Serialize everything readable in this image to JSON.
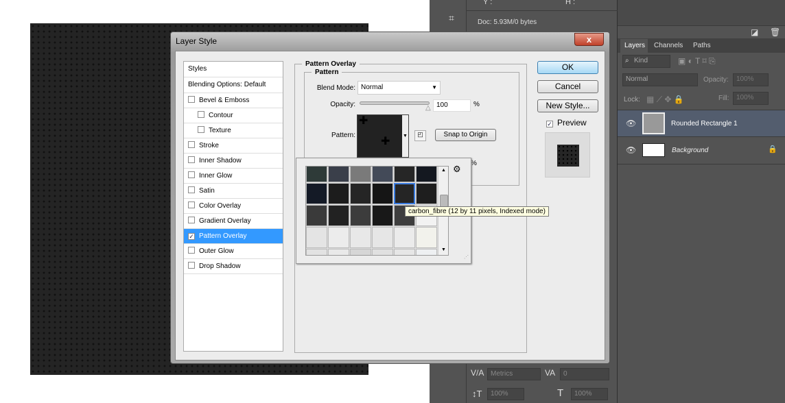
{
  "dialog": {
    "title": "Layer Style",
    "close": "x",
    "styles_header": "Styles",
    "blending": "Blending Options: Default",
    "effects": [
      {
        "label": "Bevel & Emboss",
        "checked": false,
        "indent": false
      },
      {
        "label": "Contour",
        "checked": false,
        "indent": true
      },
      {
        "label": "Texture",
        "checked": false,
        "indent": true
      },
      {
        "label": "Stroke",
        "checked": false,
        "indent": false
      },
      {
        "label": "Inner Shadow",
        "checked": false,
        "indent": false
      },
      {
        "label": "Inner Glow",
        "checked": false,
        "indent": false
      },
      {
        "label": "Satin",
        "checked": false,
        "indent": false
      },
      {
        "label": "Color Overlay",
        "checked": false,
        "indent": false
      },
      {
        "label": "Gradient Overlay",
        "checked": false,
        "indent": false
      },
      {
        "label": "Pattern Overlay",
        "checked": true,
        "indent": false,
        "selected": true
      },
      {
        "label": "Outer Glow",
        "checked": false,
        "indent": false
      },
      {
        "label": "Drop Shadow",
        "checked": false,
        "indent": false
      }
    ],
    "section": "Pattern Overlay",
    "group": "Pattern",
    "blend_label": "Blend Mode:",
    "blend_value": "Normal",
    "opacity_label": "Opacity:",
    "opacity_value": "100",
    "pct": "%",
    "opacity_slider": 100,
    "pattern_label": "Pattern:",
    "snap": "Snap to Origin",
    "scale_pct": "%",
    "ok": "OK",
    "cancel": "Cancel",
    "new_style": "New Style...",
    "preview": "Preview",
    "preview_checked": true,
    "tooltip": "carbon_fibre (12 by 11 pixels, Indexed mode)",
    "swatches": [
      [
        "#2e3a38",
        "#3a3f4a",
        "#7a7a7a",
        "#434a58",
        "#262626",
        "#141820"
      ],
      [
        "#141a26",
        "#1c1c1c",
        "#252525",
        "#151515",
        "#252525",
        "#1e1e1e"
      ],
      [
        "#3a3a3a",
        "#222",
        "#3c3c3c",
        "#181818",
        "#3e3e3e",
        "#f2f2f2"
      ],
      [
        "#e4e4e4",
        "#ececec",
        "#e8e8e8",
        "#e6e6e6",
        "#ebebeb",
        "#f2f2ec"
      ],
      [
        "#e2e2e2",
        "#e9e9e9",
        "#d6d6d6",
        "#e0e0e0",
        "#e6e6e6",
        "#eef0f2"
      ]
    ]
  },
  "info": {
    "y": "Y :",
    "h": "H :",
    "doc": "Doc: 5.93M/0 bytes"
  },
  "character": {
    "kerning": "Metrics",
    "tracking": "0",
    "vscale": "100%",
    "hscale": "100%"
  },
  "layers": {
    "tabs": [
      "Layers",
      "Channels",
      "Paths"
    ],
    "kind": "Kind",
    "blend": "Normal",
    "opacity_label": "Opacity:",
    "opacity": "100%",
    "lock_label": "Lock:",
    "fill_label": "Fill:",
    "fill": "100%",
    "items": [
      {
        "name": "Rounded Rectangle 1",
        "selected": true
      },
      {
        "name": "Background",
        "locked": true
      }
    ]
  }
}
